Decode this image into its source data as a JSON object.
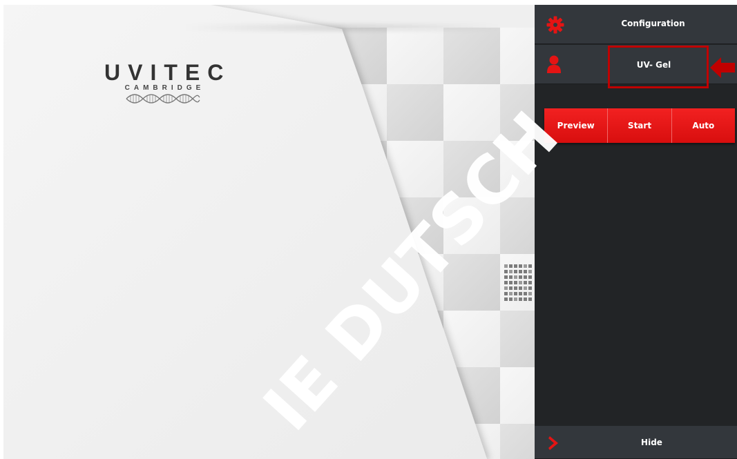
{
  "splash": {
    "logo_title": "UVITEC",
    "logo_subtitle": "CAMBRIDGE"
  },
  "sidebar": {
    "config_label": "Configuration",
    "profile_label": "UV- Gel",
    "hide_label": "Hide",
    "actions": [
      {
        "label": "Preview"
      },
      {
        "label": "Start"
      },
      {
        "label": "Auto"
      }
    ]
  },
  "watermark": "IE DUTSCH",
  "icons": {
    "config": "gear-icon",
    "profile": "user-icon",
    "hide": "chevron-right-icon",
    "callout": "arrow-left-icon"
  },
  "colors": {
    "panel_bg": "#222426",
    "bar_bg": "#33373c",
    "accent_red": "#e41414",
    "highlight": "#c00000"
  }
}
